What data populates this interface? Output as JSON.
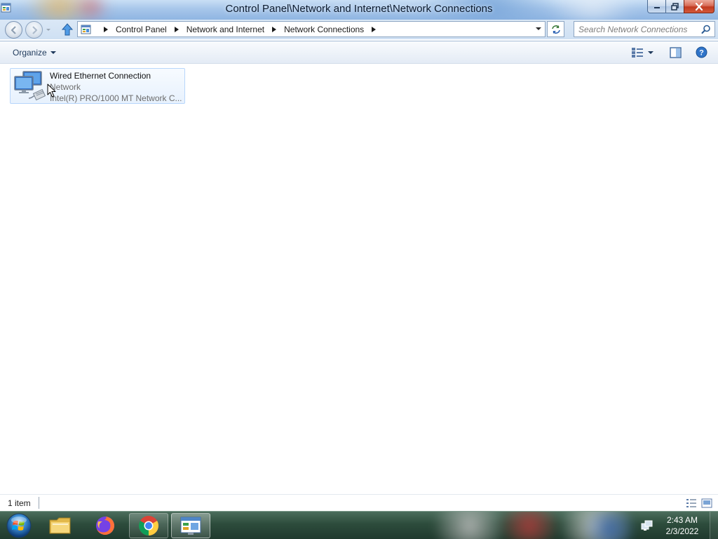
{
  "window": {
    "title": "Control Panel\\Network and Internet\\Network Connections",
    "title_icon": "control-panel-icon",
    "caption_buttons": [
      "minimize",
      "restore",
      "close"
    ]
  },
  "address_bar": {
    "breadcrumb": [
      "Control Panel",
      "Network and Internet",
      "Network Connections"
    ],
    "search_placeholder": "Search Network Connections"
  },
  "command_bar": {
    "organize_label": "Organize",
    "right_icons": [
      "change-view-icon",
      "preview-pane-icon",
      "help-icon"
    ]
  },
  "connections": [
    {
      "name": "Wired Ethernet Connection",
      "status": "Network",
      "device": "Intel(R) PRO/1000 MT Network C...",
      "icon": "network-adapter-icon"
    }
  ],
  "status_bar": {
    "item_count": "1 item"
  },
  "taskbar": {
    "apps": [
      "windows-explorer-icon",
      "firefox-icon",
      "chrome-icon",
      "control-panel-icon"
    ],
    "active_app": "control-panel-icon"
  },
  "tray": {
    "time": "2:43 AM",
    "date": "2/3/2022",
    "icons": [
      "network-icon"
    ]
  },
  "colors": {
    "selection_border": "#b8d6fb",
    "selection_fill": "#e7f1fd",
    "close_button": "#c1391f",
    "secondary_text": "#6d6d6d"
  }
}
